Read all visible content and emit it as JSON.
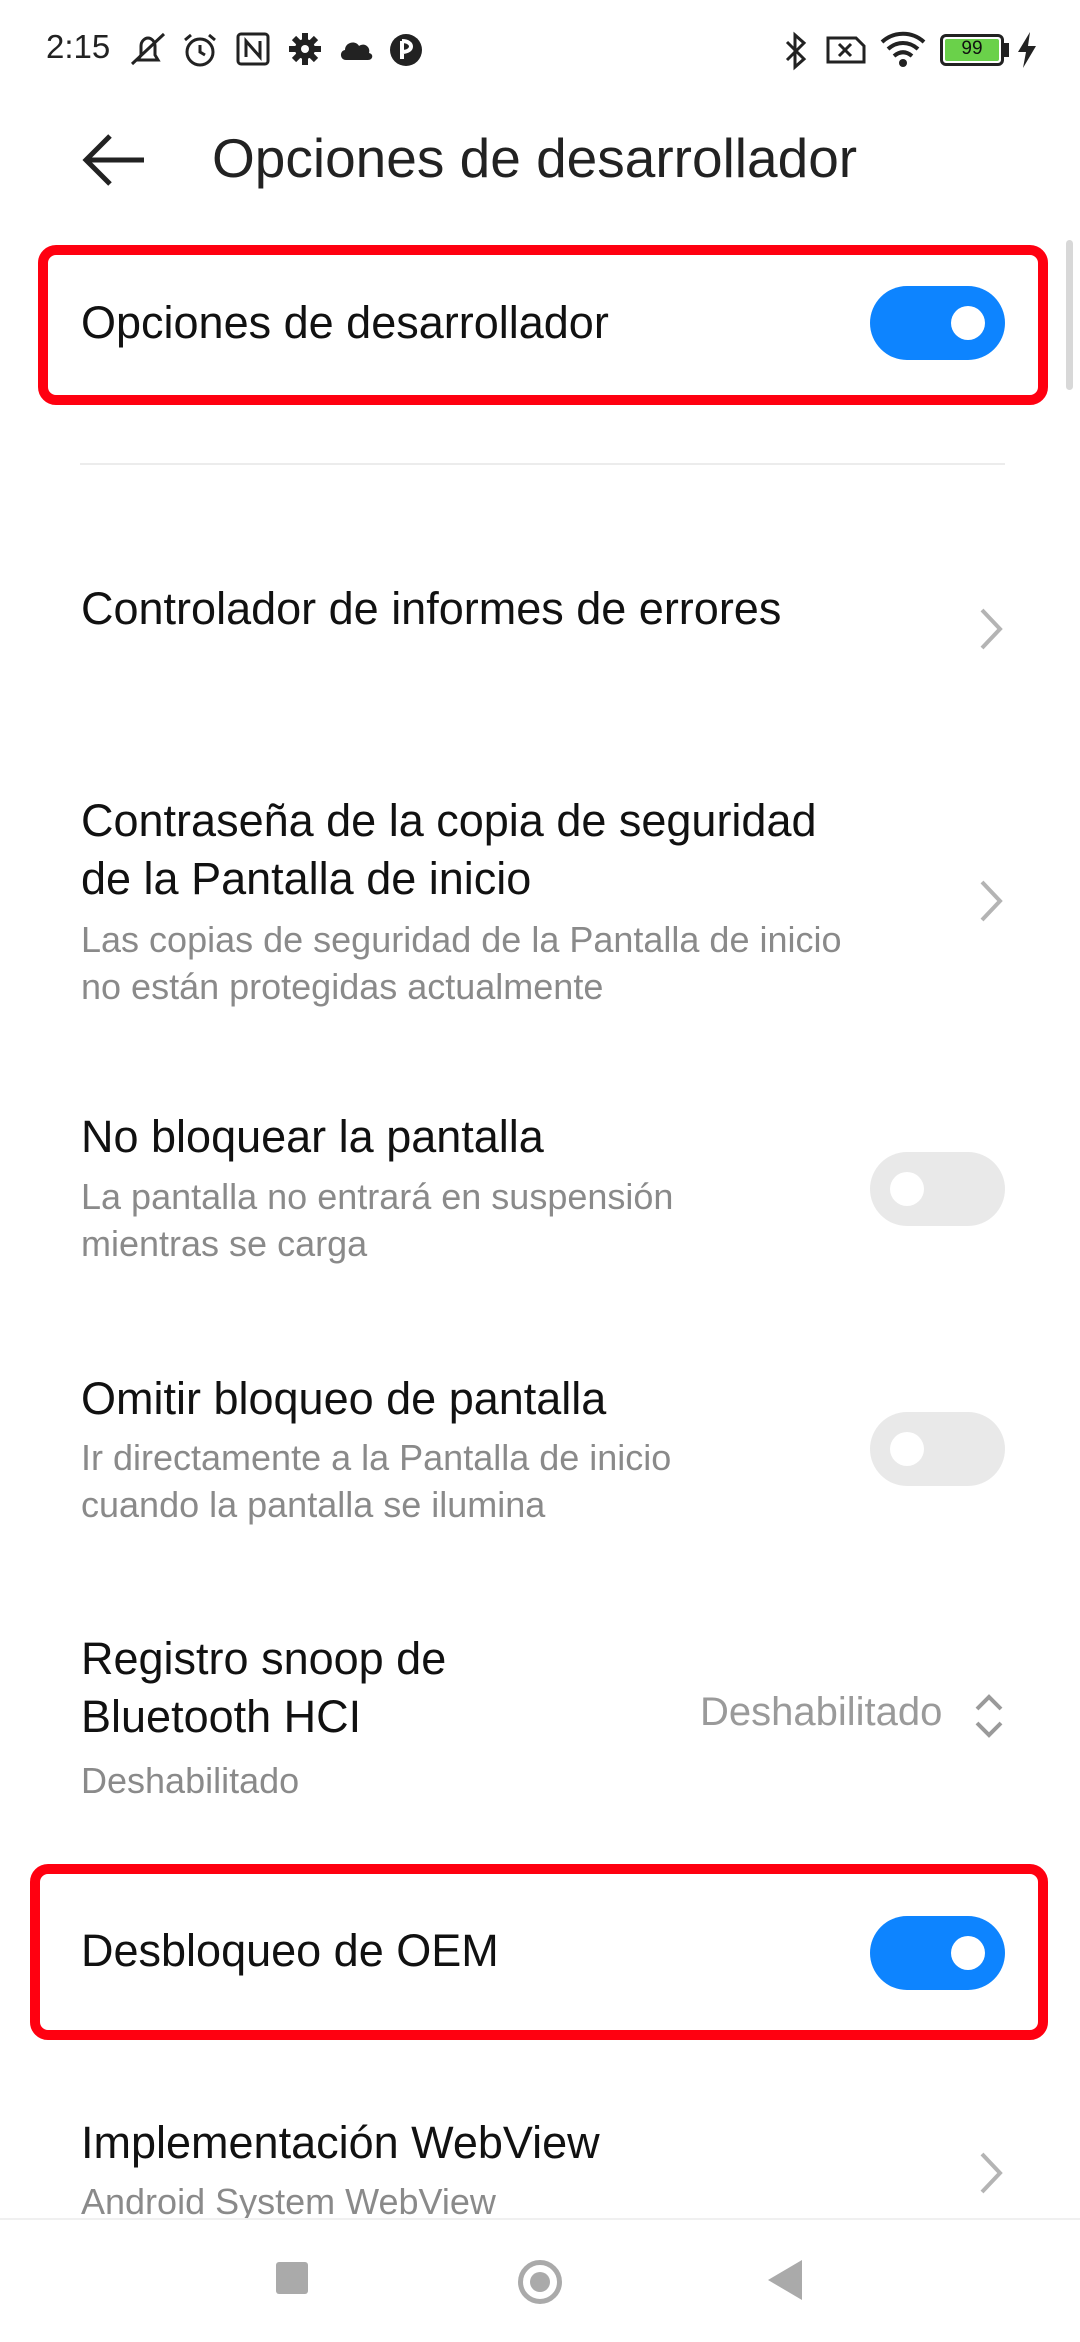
{
  "status_bar": {
    "time": "2:15",
    "battery": "99",
    "left_icons": [
      "mute-notifications-icon",
      "alarm-icon",
      "nfc-icon",
      "settings-gear-icon",
      "cloud-icon",
      "app-icon"
    ],
    "right_icons": [
      "bluetooth-icon",
      "no-sim-icon",
      "wifi-icon",
      "battery-icon",
      "charging-icon"
    ]
  },
  "header": {
    "title": "Opciones de desarrollador"
  },
  "settings": {
    "developer_options": {
      "label": "Opciones de desarrollador",
      "enabled": true
    },
    "bug_report": {
      "label": "Controlador de informes de errores"
    },
    "backup_password": {
      "label_line1": "Contraseña de la copia de seguridad",
      "label_line2": "de la Pantalla de inicio",
      "sub_line1": "Las copias de seguridad de la Pantalla de inicio",
      "sub_line2": "no están protegidas actualmente"
    },
    "stay_awake": {
      "label": "No bloquear la pantalla",
      "sub_line1": "La pantalla no entrará en suspensión",
      "sub_line2": "mientras se carga",
      "enabled": false
    },
    "skip_lockscreen": {
      "label": "Omitir bloqueo de pantalla",
      "sub_line1": "Ir directamente a la Pantalla de inicio",
      "sub_line2": "cuando la pantalla se ilumina",
      "enabled": false
    },
    "bt_snoop": {
      "label_line1": "Registro snoop de",
      "label_line2": "Bluetooth HCI",
      "sub": "Deshabilitado",
      "value": "Deshabilitado"
    },
    "oem_unlock": {
      "label": "Desbloqueo de OEM",
      "enabled": true
    },
    "webview": {
      "label": "Implementación WebView",
      "sub": "Android System WebView"
    }
  },
  "colors": {
    "accent": "#0d84ff",
    "highlight": "#ff0010",
    "toggle_off": "#e9e9e9"
  }
}
